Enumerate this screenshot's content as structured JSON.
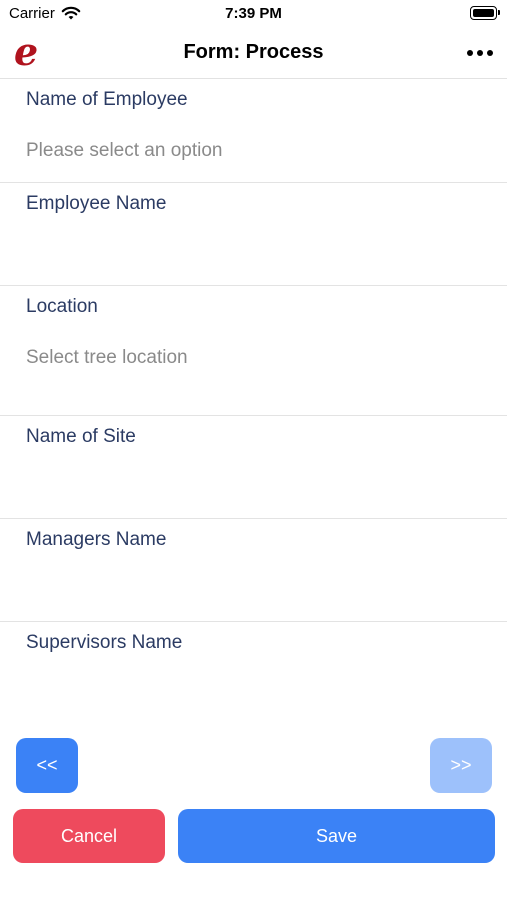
{
  "status": {
    "carrier": "Carrier",
    "time": "7:39 PM"
  },
  "header": {
    "logo": "e",
    "title": "Form: Process",
    "more_icon": "ellipsis-icon"
  },
  "fields": [
    {
      "label": "Name of Employee",
      "value": "Please select an option"
    },
    {
      "label": "Employee Name",
      "value": ""
    },
    {
      "label": "Location",
      "value": "Select tree location"
    },
    {
      "label": "Name of Site",
      "value": ""
    },
    {
      "label": "Managers Name",
      "value": ""
    },
    {
      "label": "Supervisors Name",
      "value": ""
    }
  ],
  "buttons": {
    "prev": "<<",
    "next": ">>",
    "cancel": "Cancel",
    "save": "Save"
  },
  "colors": {
    "primary": "#3b82f6",
    "primary_disabled": "#9dc1fb",
    "danger": "#ee4a5d",
    "brand": "#b0131e",
    "label": "#2b3b63"
  }
}
